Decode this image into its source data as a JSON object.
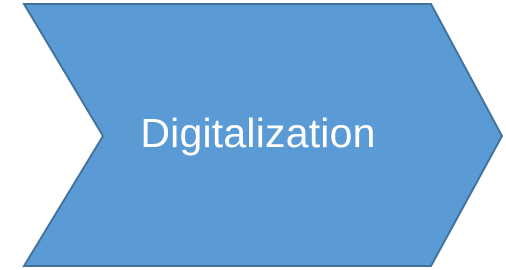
{
  "shape": {
    "kind": "chevron",
    "label": "Digitalization",
    "fill_color": "#5b9bd5",
    "stroke_color": "#41719c",
    "text_color": "#ffffff"
  }
}
